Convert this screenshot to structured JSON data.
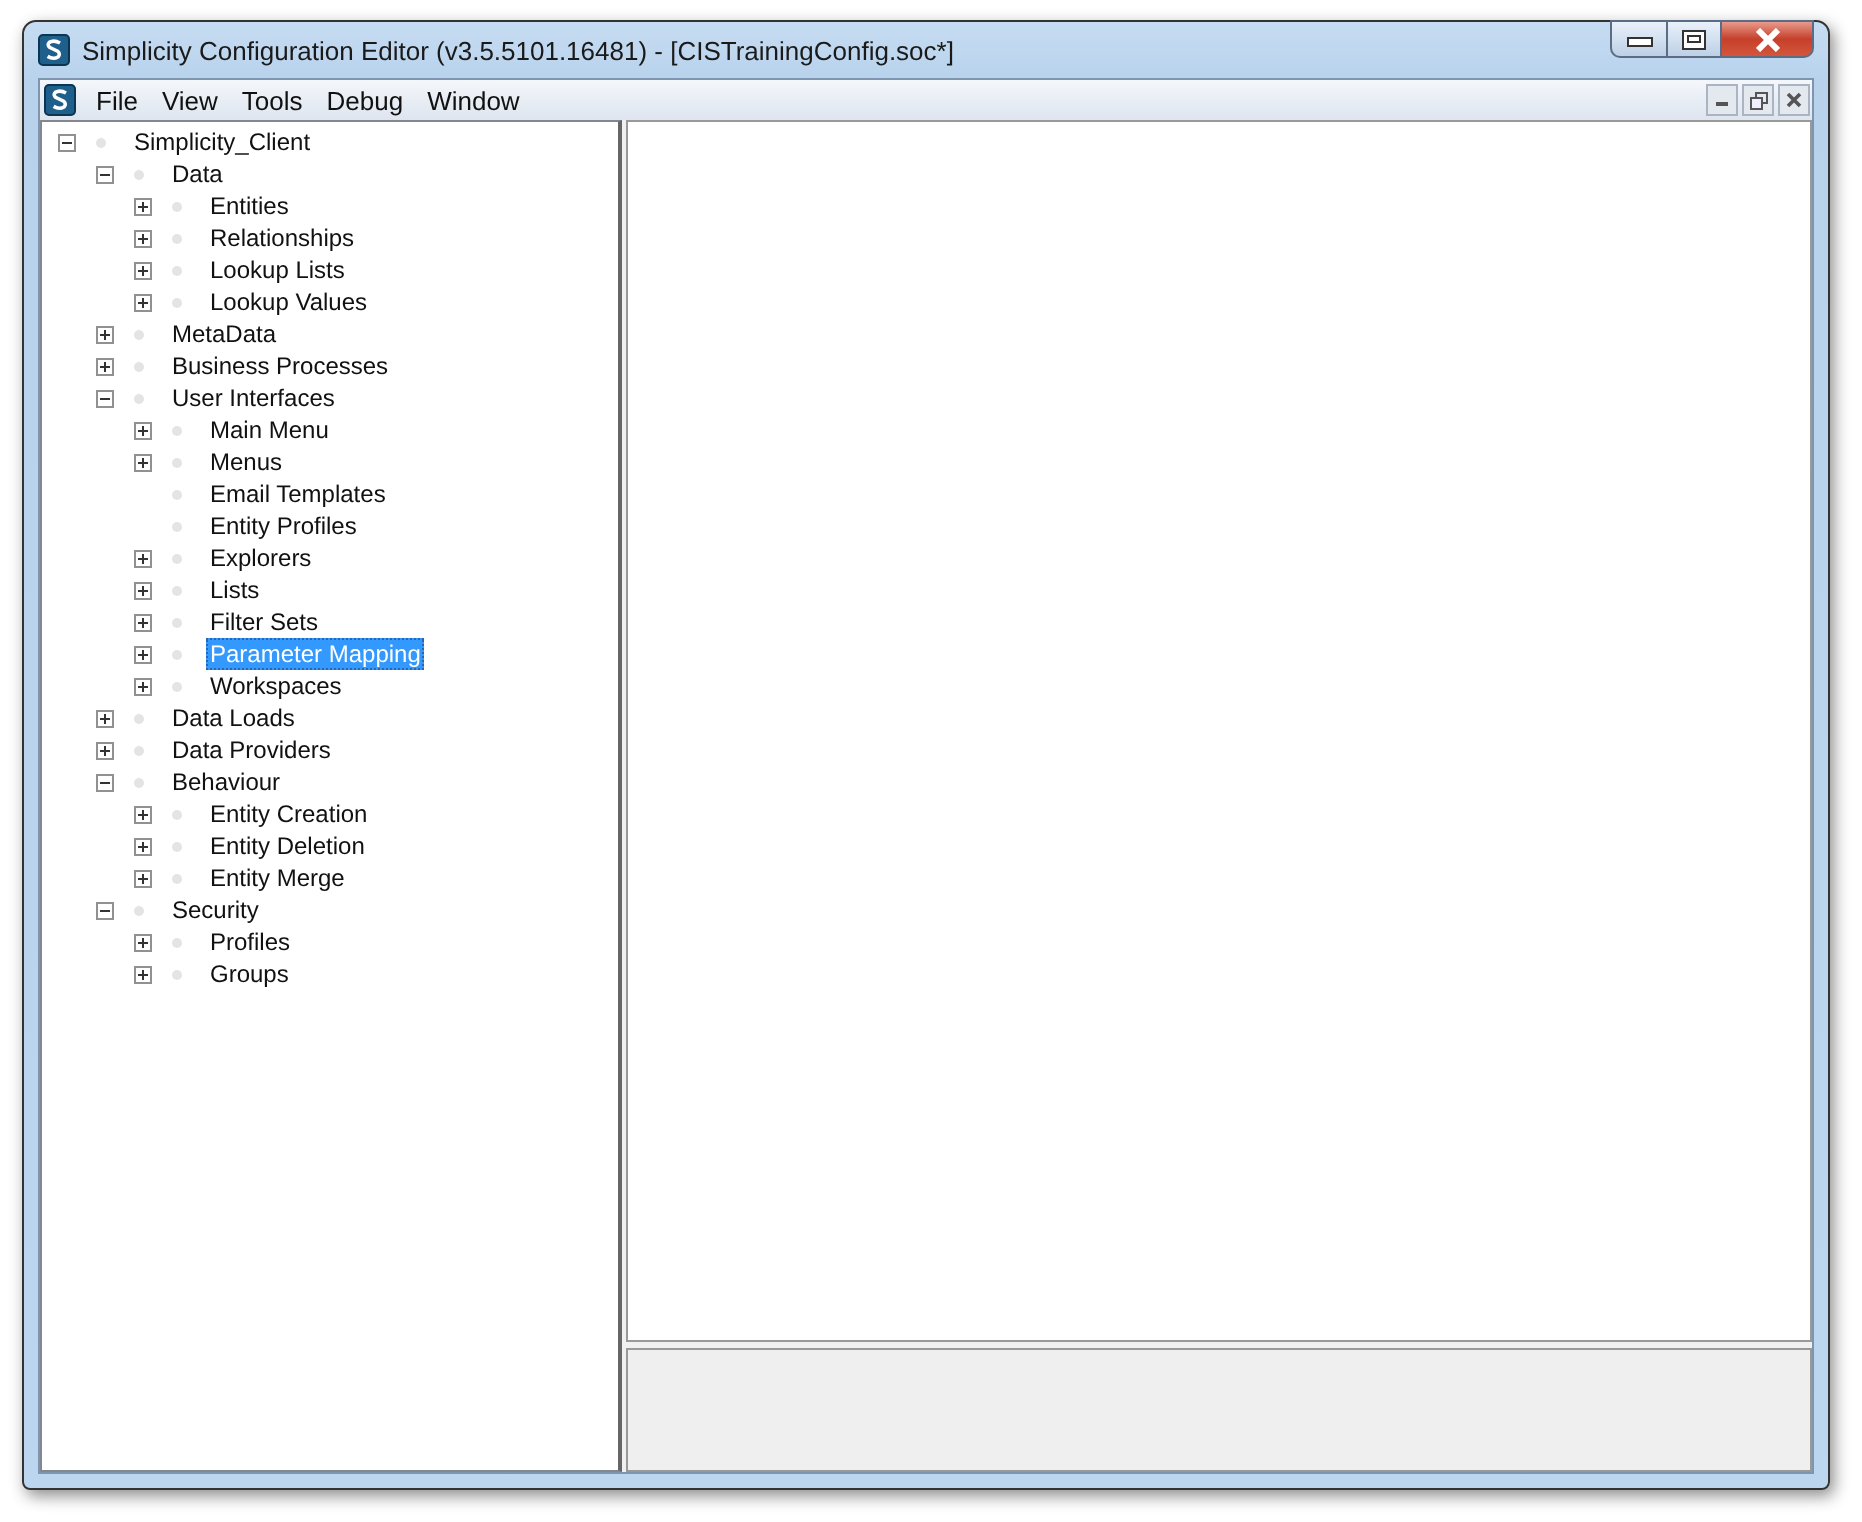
{
  "window": {
    "title": "Simplicity Configuration Editor (v3.5.5101.16481) - [CISTrainingConfig.soc*]"
  },
  "menu": [
    "File",
    "View",
    "Tools",
    "Debug",
    "Window"
  ],
  "tree": [
    {
      "label": "Simplicity_Client",
      "expanded": true,
      "selected": false,
      "children": [
        {
          "label": "Data",
          "expanded": true,
          "selected": false,
          "children": [
            {
              "label": "Entities",
              "expanded": false,
              "selected": false
            },
            {
              "label": "Relationships",
              "expanded": false,
              "selected": false
            },
            {
              "label": "Lookup Lists",
              "expanded": false,
              "selected": false
            },
            {
              "label": "Lookup Values",
              "expanded": false,
              "selected": false
            }
          ]
        },
        {
          "label": "MetaData",
          "expanded": false,
          "selected": false
        },
        {
          "label": "Business Processes",
          "expanded": false,
          "selected": false
        },
        {
          "label": "User Interfaces",
          "expanded": true,
          "selected": false,
          "children": [
            {
              "label": "Main Menu",
              "expanded": false,
              "selected": false
            },
            {
              "label": "Menus",
              "expanded": false,
              "selected": false
            },
            {
              "label": "Email Templates",
              "selected": false
            },
            {
              "label": "Entity Profiles",
              "selected": false
            },
            {
              "label": "Explorers",
              "expanded": false,
              "selected": false
            },
            {
              "label": "Lists",
              "expanded": false,
              "selected": false
            },
            {
              "label": "Filter Sets",
              "expanded": false,
              "selected": false
            },
            {
              "label": "Parameter Mapping",
              "expanded": false,
              "selected": true
            },
            {
              "label": "Workspaces",
              "expanded": false,
              "selected": false
            }
          ]
        },
        {
          "label": "Data Loads",
          "expanded": false,
          "selected": false
        },
        {
          "label": "Data Providers",
          "expanded": false,
          "selected": false
        },
        {
          "label": "Behaviour",
          "expanded": true,
          "selected": false,
          "children": [
            {
              "label": "Entity Creation",
              "expanded": false,
              "selected": false
            },
            {
              "label": "Entity Deletion",
              "expanded": false,
              "selected": false
            },
            {
              "label": "Entity Merge",
              "expanded": false,
              "selected": false
            }
          ]
        },
        {
          "label": "Security",
          "expanded": true,
          "selected": false,
          "children": [
            {
              "label": "Profiles",
              "expanded": false,
              "selected": false
            },
            {
              "label": "Groups",
              "expanded": false,
              "selected": false
            }
          ]
        }
      ]
    }
  ]
}
